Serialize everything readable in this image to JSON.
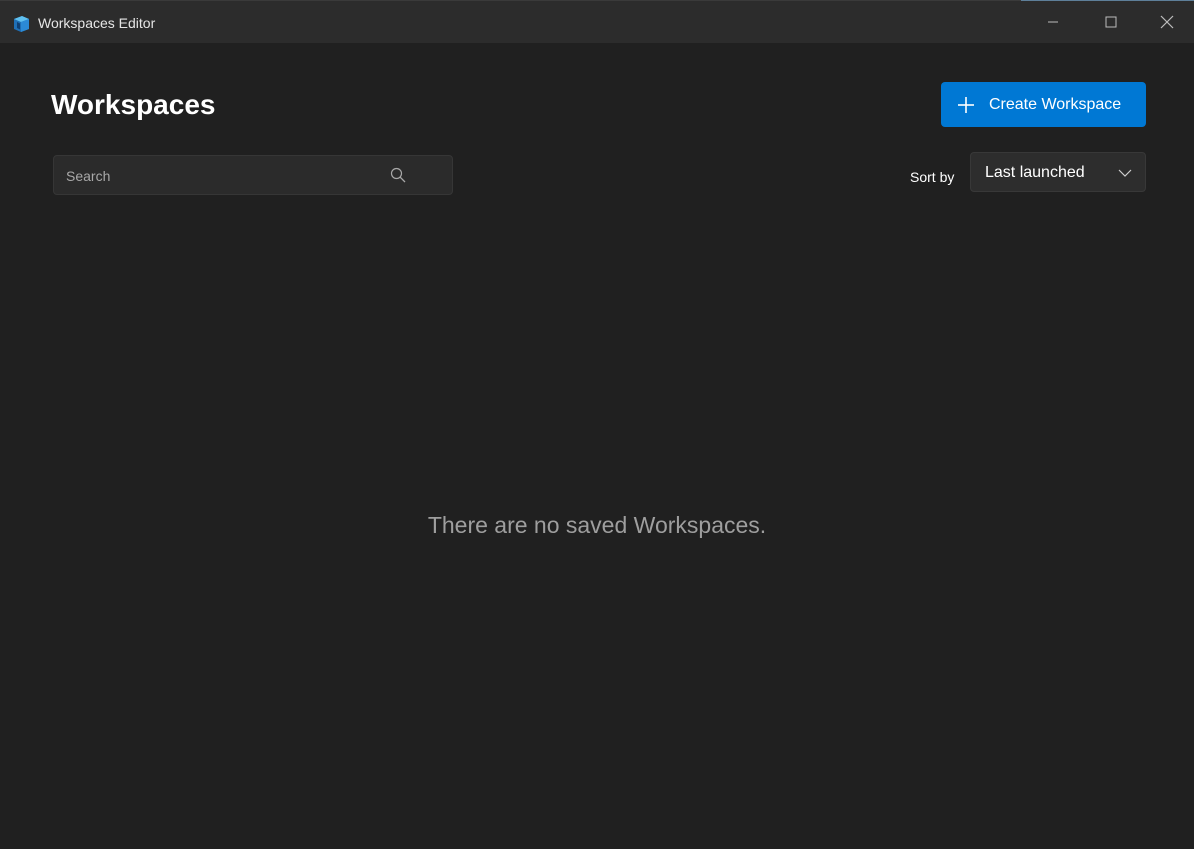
{
  "window": {
    "title": "Workspaces Editor",
    "icon": "workspaces-app-icon",
    "controls": {
      "minimize_icon": "minimize-icon",
      "maximize_icon": "maximize-icon",
      "close_icon": "close-icon"
    }
  },
  "header": {
    "title": "Workspaces",
    "create_button": {
      "label": "Create Workspace",
      "icon": "plus-icon"
    }
  },
  "search": {
    "placeholder": "Search",
    "value": "",
    "icon": "search-icon"
  },
  "sort": {
    "label": "Sort by",
    "selected": "Last launched",
    "icon": "chevron-down-icon"
  },
  "empty_state": {
    "message": "There are no saved Workspaces."
  },
  "colors": {
    "background": "#202020",
    "titlebar": "#2c2c2c",
    "accent": "#0078d4",
    "muted_text": "#9e9e9e"
  }
}
